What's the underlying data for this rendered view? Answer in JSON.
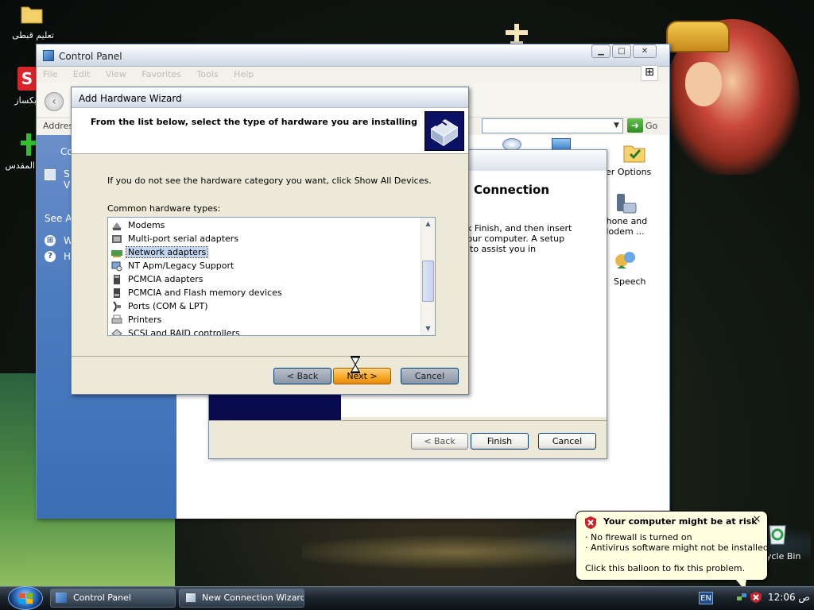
{
  "desktop": {
    "icons": [
      {
        "label": "تعليم قبطى"
      },
      {
        "label": "بكساز"
      },
      {
        "label": "المقدس"
      },
      {
        "label": "ycle Bin"
      }
    ]
  },
  "control_panel": {
    "title": "Control Panel",
    "menu": [
      "File",
      "Edit",
      "View",
      "Favorites",
      "Tools",
      "Help"
    ],
    "address_label": "Address",
    "go_label": "Go",
    "taskpane": {
      "heading_fragment": "Co",
      "switch_fragment_1": "S",
      "switch_fragment_2": "V",
      "see_also_fragment": "See A",
      "link_fragment_1": "W",
      "link_fragment_2": "H"
    },
    "items": [
      {
        "label": "lder Options",
        "icon": "folder-options-icon"
      },
      {
        "label": "Phone and\nModem ...",
        "icon": "phone-modem-icon"
      },
      {
        "label": "Speech",
        "icon": "speech-icon"
      }
    ]
  },
  "new_connection_wizard": {
    "heading_fragment": "Connection",
    "body_fragment": "ck Finish, and then insert\nyour computer. A setup\ny to assist you in",
    "buttons": {
      "back": "< Back",
      "finish": "Finish",
      "cancel": "Cancel"
    }
  },
  "add_hardware_wizard": {
    "title": "Add Hardware Wizard",
    "header_text": "From the list below, select the type of hardware you are installing",
    "hint": "If you do not see the hardware category you want, click Show All Devices.",
    "list_label": "Common hardware types:",
    "list_items": [
      {
        "label": "Modems",
        "icon": "modem-icon",
        "selected": false
      },
      {
        "label": "Multi-port serial adapters",
        "icon": "serial-adapter-icon",
        "selected": false
      },
      {
        "label": "Network adapters",
        "icon": "network-adapter-icon",
        "selected": true
      },
      {
        "label": "NT Apm/Legacy Support",
        "icon": "legacy-support-icon",
        "selected": false
      },
      {
        "label": "PCMCIA adapters",
        "icon": "pcmcia-icon",
        "selected": false
      },
      {
        "label": "PCMCIA and Flash memory devices",
        "icon": "flash-memory-icon",
        "selected": false
      },
      {
        "label": "Ports (COM & LPT)",
        "icon": "ports-icon",
        "selected": false
      },
      {
        "label": "Printers",
        "icon": "printer-icon",
        "selected": false
      },
      {
        "label": "SCSI and RAID controllers",
        "icon": "scsi-icon",
        "selected": false
      }
    ],
    "buttons": {
      "back": "< Back",
      "next": "Next >",
      "cancel": "Cancel"
    }
  },
  "security_balloon": {
    "title": "Your computer might be at risk",
    "lines": [
      "· No firewall is turned on",
      "· Antivirus software might not be installed"
    ],
    "action": "Click this balloon to fix this problem."
  },
  "taskbar": {
    "tasks": [
      "Control Panel",
      "New Connection Wizard"
    ],
    "language": "EN",
    "clock": "12:06 ص"
  },
  "colors": {
    "taskpane_blue": "#4d7cc0",
    "selection": "#c2d5f0",
    "balloon": "#ffffe1",
    "next_button_highlight": "#f5a623"
  }
}
